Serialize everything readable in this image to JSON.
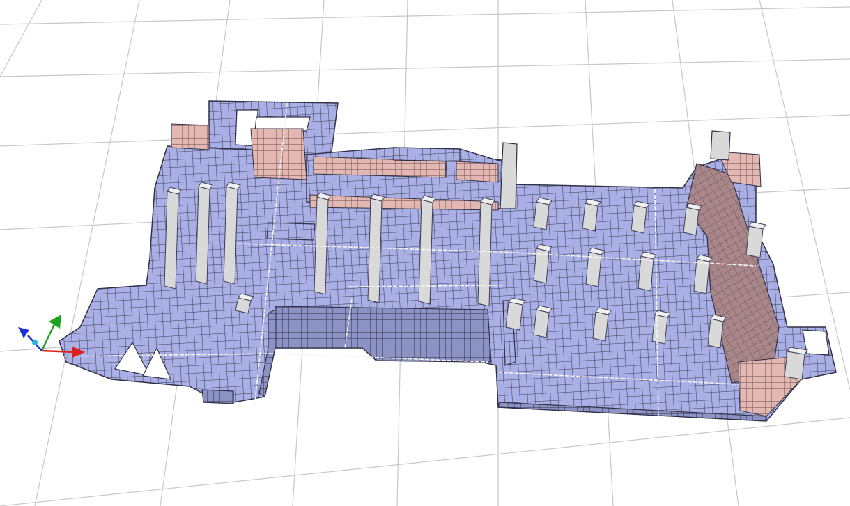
{
  "viewport": {
    "background": "#ffffff"
  },
  "colors": {
    "floor_grid": "#c7c7c7",
    "slab_fill": "#aab0e6",
    "mesh_line": "#3b3e55",
    "wall_pink": "#e3b8b3",
    "wall_mauve": "#a9868a",
    "column_fill": "#d9d9d9",
    "column_top": "#f0f0f0",
    "axis_x": "#e0201b",
    "axis_y": "#1fa31f",
    "axis_z": "#1a2fd4",
    "axis_origin": "#1fb6e0"
  },
  "icons": [
    "axis-triad-icon"
  ]
}
